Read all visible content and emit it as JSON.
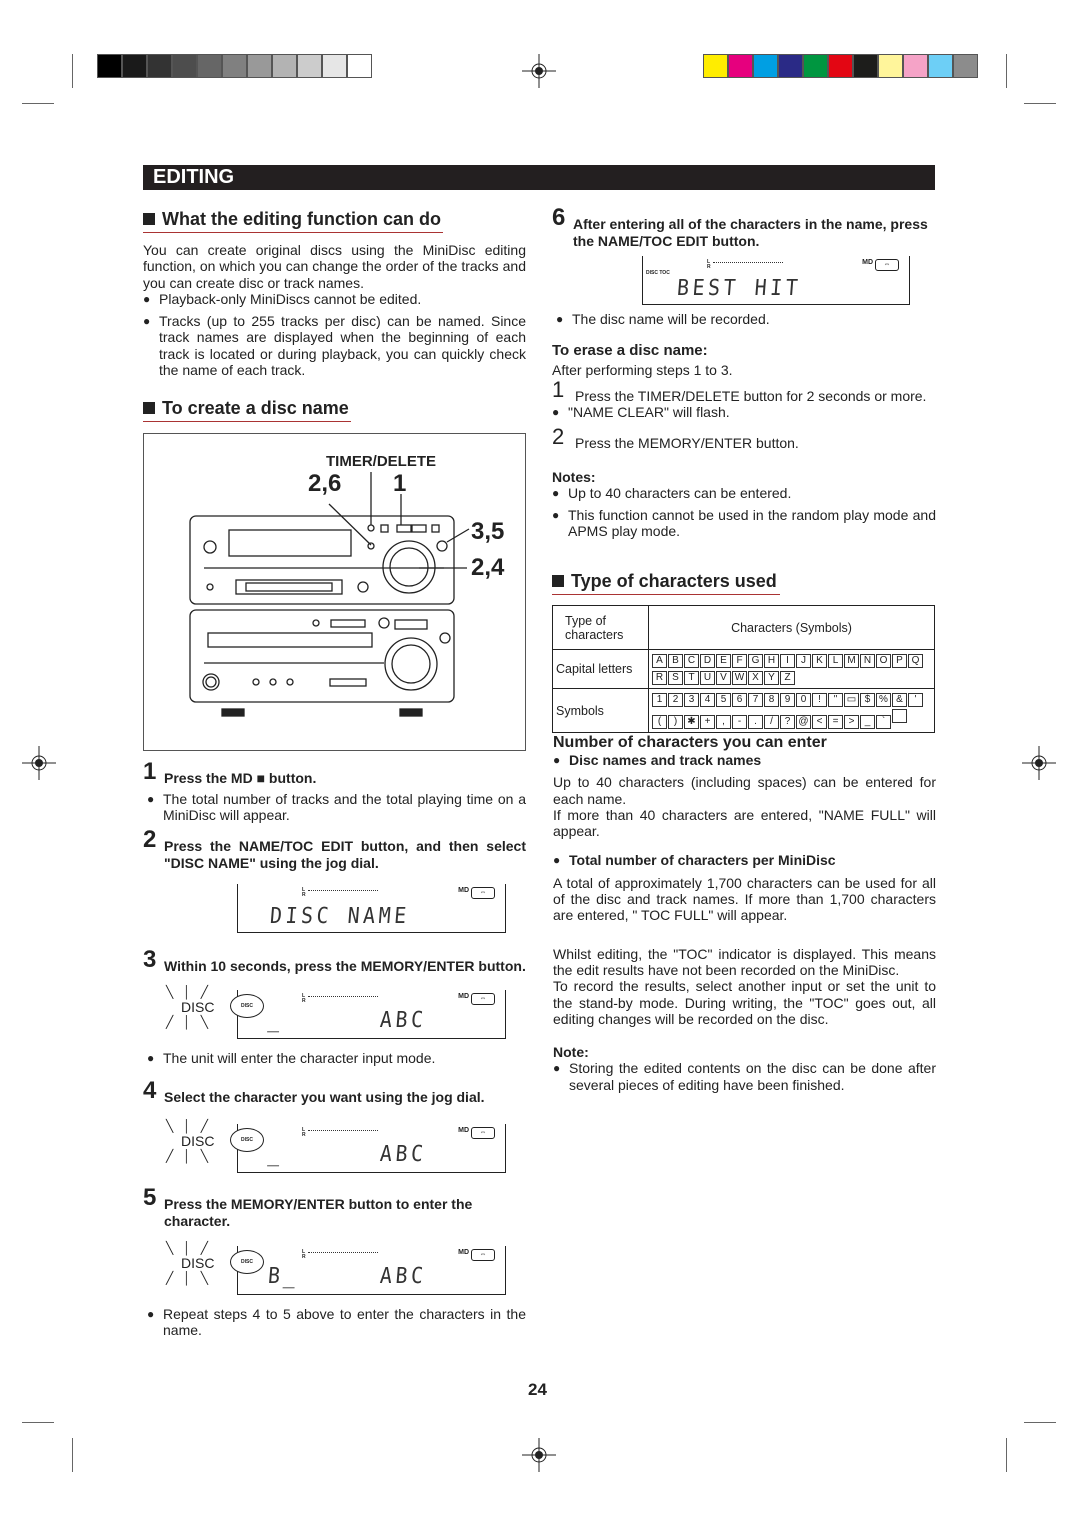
{
  "registration": {
    "gray_swatches": [
      "#000000",
      "#1a1a1a",
      "#333333",
      "#4d4d4d",
      "#666666",
      "#808080",
      "#999999",
      "#b3b3b3",
      "#cccccc",
      "#e6e6e6",
      "#ffffff"
    ],
    "color_swatches": [
      "#ffed00",
      "#e6007e",
      "#009fe3",
      "#2a2a86",
      "#009640",
      "#e30613",
      "#1d1d1b",
      "#fff59b",
      "#f5a3c7",
      "#6dcff6",
      "#8c8c8c"
    ]
  },
  "header": {
    "title": "EDITING"
  },
  "left": {
    "sec1": {
      "title": "What the editing function can do",
      "intro": "You can create original discs using the MiniDisc editing function, on which you can change the order of the tracks and you can create disc or track names.",
      "bullets": [
        "Playback-only MiniDiscs cannot be edited.",
        "Tracks (up to 255 tracks per disc) can be named. Since track names are displayed when the beginning of each track is located or during playback, you can quickly check the name of each track."
      ]
    },
    "sec2": {
      "title": "To create a disc name"
    },
    "figure": {
      "timer_delete": "TIMER/DELETE",
      "c26": "2,6",
      "c1": "1",
      "c35": "3,5",
      "c24": "2,4"
    },
    "steps": [
      {
        "num": "1",
        "text": "Press the MD ■ button.",
        "note": "The total number of tracks and the total playing time on a MiniDisc will appear."
      },
      {
        "num": "2",
        "text": "Press the NAME/TOC EDIT button, and then select \"DISC NAME\" using the jog dial.",
        "lcd": "DISC  NAME"
      },
      {
        "num": "3",
        "text": "Within 10 seconds, press the MEMORY/ENTER button.",
        "lcd_left": "_",
        "lcd_right": "ABC",
        "note": "The unit will enter the character input mode."
      },
      {
        "num": "4",
        "text": "Select the character you want using the jog dial.",
        "lcd_left": "_",
        "lcd_right": "ABC"
      },
      {
        "num": "5",
        "text": "Press the MEMORY/ENTER button to enter the character.",
        "lcd_left": "B_",
        "lcd_right": "ABC",
        "note": "Repeat steps 4 to 5 above to enter the characters in the name."
      }
    ],
    "lcd_labels": {
      "l": "L",
      "r": "R",
      "md": "MD",
      "disc": "DISC",
      "disc_small": "DISC",
      "disc_toc": "DISC TOC"
    }
  },
  "right": {
    "step6": {
      "num": "6",
      "text": "After entering all of the characters in the name, press the NAME/TOC EDIT button.",
      "lcd": "BEST  HIT",
      "note": "The disc name will be recorded."
    },
    "erase": {
      "title": "To erase a disc name:",
      "sub": "After performing steps 1 to 3.",
      "steps": [
        {
          "num": "1",
          "text": "Press the TIMER/DELETE button for 2 seconds or more.",
          "note": "\"NAME CLEAR\" will flash."
        },
        {
          "num": "2",
          "text": "Press the MEMORY/ENTER button."
        }
      ]
    },
    "notes": {
      "title": "Notes:",
      "items": [
        "Up to 40 characters can be entered.",
        "This function cannot be used in the random play mode and APMS play mode."
      ]
    },
    "types": {
      "title": "Type of characters used",
      "col1": "Type of characters",
      "col2": "Characters (Symbols)",
      "row1_label": "Capital letters",
      "row1": [
        "A",
        "B",
        "C",
        "D",
        "E",
        "F",
        "G",
        "H",
        "I",
        "J",
        "K",
        "L",
        "M",
        "N",
        "O",
        "P",
        "Q",
        "R",
        "S",
        "T",
        "U",
        "V",
        "W",
        "X",
        "Y",
        "Z"
      ],
      "row2_label": "Symbols",
      "row2": [
        "1",
        "2",
        "3",
        "4",
        "5",
        "6",
        "7",
        "8",
        "9",
        "0",
        "!",
        "\"",
        "▭",
        "$",
        "%",
        "&",
        "'",
        "(",
        ")",
        "✱",
        "+",
        ",",
        "-",
        ".",
        "/",
        "?",
        "@",
        "<",
        "=",
        ">",
        "_",
        "`",
        " "
      ]
    },
    "count": {
      "title": "Number of characters you can enter",
      "sub1": "Disc names and track names",
      "p1": "Up to 40 characters (including spaces) can be entered for each name.",
      "p2": "If more than 40 characters are entered, \"NAME   FULL\" will appear.",
      "sub2": "Total number of characters per MiniDisc",
      "p3": "A total of approximately 1,700 characters can be used for all of the disc and track names. If more than 1,700 characters are entered, \" TOC FULL\" will appear.",
      "p4": "Whilst editing, the \"TOC\" indicator is displayed. This means the edit results have not been recorded on the MiniDisc.",
      "p5": "To record the results, select another input or set the unit to the stand-by mode. During writing, the \"TOC\" goes out, all editing changes will be recorded on the disc."
    },
    "note": {
      "title": "Note:",
      "text": "Storing the edited contents on the disc can be done after several pieces of editing have been finished."
    }
  },
  "page_number": "24"
}
